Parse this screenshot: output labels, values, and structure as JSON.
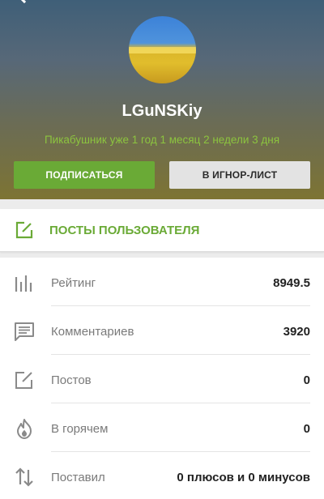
{
  "header": {
    "username": "LGuNSKiy",
    "tenure": "Пикабушник уже 1 год 1 месяц 2 недели 3 дня",
    "subscribe_label": "ПОДПИСАТЬСЯ",
    "ignore_label": "В ИГНОР-ЛИСТ"
  },
  "posts_tab": {
    "label": "ПОСТЫ ПОЛЬЗОВАТЕЛЯ",
    "icon": "edit-icon"
  },
  "stats": [
    {
      "icon": "bar-chart-icon",
      "label": "Рейтинг",
      "value": "8949.5"
    },
    {
      "icon": "comment-icon",
      "label": "Комментариев",
      "value": "3920"
    },
    {
      "icon": "edit-icon",
      "label": "Постов",
      "value": "0"
    },
    {
      "icon": "flame-icon",
      "label": "В горячем",
      "value": "0"
    },
    {
      "icon": "up-down-arrows-icon",
      "label": "Поставил",
      "value": "0 плюсов и 0 минусов"
    }
  ],
  "colors": {
    "accent_green": "#6aaa36",
    "tenure_green": "#8cc43f",
    "icon_gray": "#8a8a8a"
  }
}
